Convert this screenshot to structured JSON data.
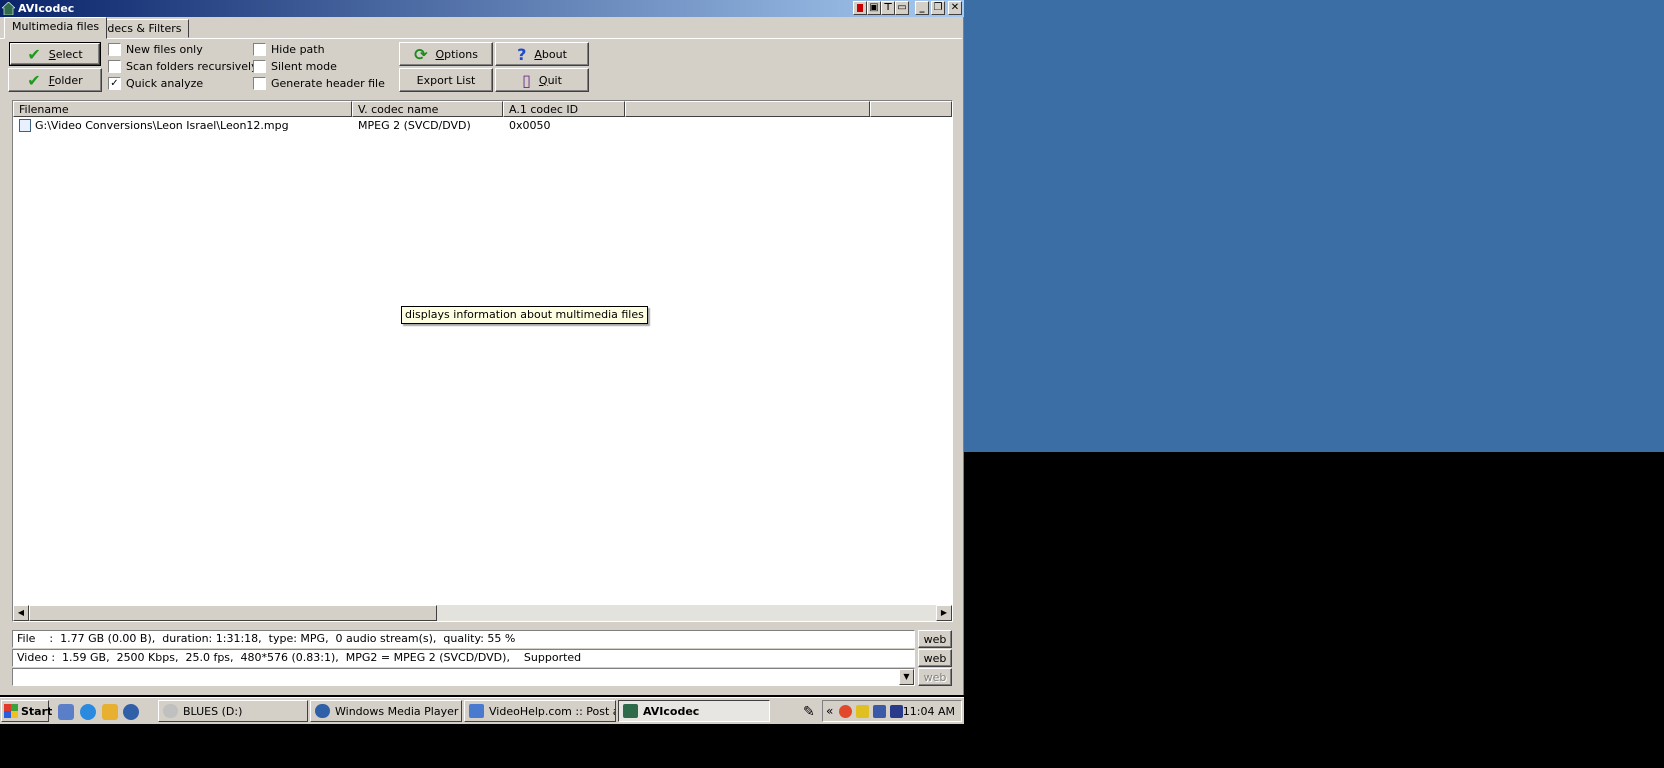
{
  "window": {
    "title": "AVIcodec",
    "controls": [
      "extra-1",
      "extra-2",
      "extra-3",
      "extra-4",
      "minimize",
      "restore",
      "close"
    ]
  },
  "tabs": [
    {
      "label": "Multimedia files",
      "active": true
    },
    {
      "label": "Codecs & Filters",
      "active": false
    }
  ],
  "buttons": {
    "select": "Select",
    "folder": "Folder",
    "options": "Options",
    "about": "About",
    "export_list": "Export List",
    "quit": "Quit"
  },
  "checkboxes": [
    {
      "label": "New files only",
      "checked": false
    },
    {
      "label": "Scan folders recursively",
      "checked": false
    },
    {
      "label": "Quick analyze",
      "checked": true
    },
    {
      "label": "Hide path",
      "checked": false
    },
    {
      "label": "Silent mode",
      "checked": false
    },
    {
      "label": "Generate header file",
      "checked": false
    }
  ],
  "list": {
    "columns": [
      "Filename",
      "V. codec name",
      "A.1 codec ID",
      "",
      ""
    ],
    "rows": [
      {
        "filename": "G:\\Video Conversions\\Leon Israel\\Leon12.mpg",
        "vcodec": "MPEG 2 (SVCD/DVD)",
        "acodec_id": "0x0050"
      }
    ]
  },
  "tooltip": "displays information about multimedia files",
  "info": {
    "file_line": "File    :  1.77 GB (0.00 B),  duration: 1:31:18,  type: MPG,  0 audio stream(s),  quality: 55 %",
    "video_line": "Video :  1.59 GB,  2500 Kbps,  25.0 fps,  480*576 (0.83:1),  MPG2 = MPEG 2 (SVCD/DVD),    Supported",
    "third_line": "",
    "web_label": "web"
  },
  "taskbar": {
    "start": "Start",
    "tasks": [
      {
        "label": "BLUES (D:)",
        "active": false
      },
      {
        "label": "Windows Media Player",
        "active": false
      },
      {
        "label": "VideoHelp.com :: Post a ...",
        "active": false
      },
      {
        "label": "AVIcodec",
        "active": true
      }
    ],
    "tray_chevron": "«",
    "clock": "11:04 AM"
  },
  "colors": {
    "title_start": "#0a246a",
    "title_end": "#a6caf0",
    "face": "#d4d0c8",
    "desktop": "#3a6ea5",
    "check_green": "#1e9a1e"
  }
}
